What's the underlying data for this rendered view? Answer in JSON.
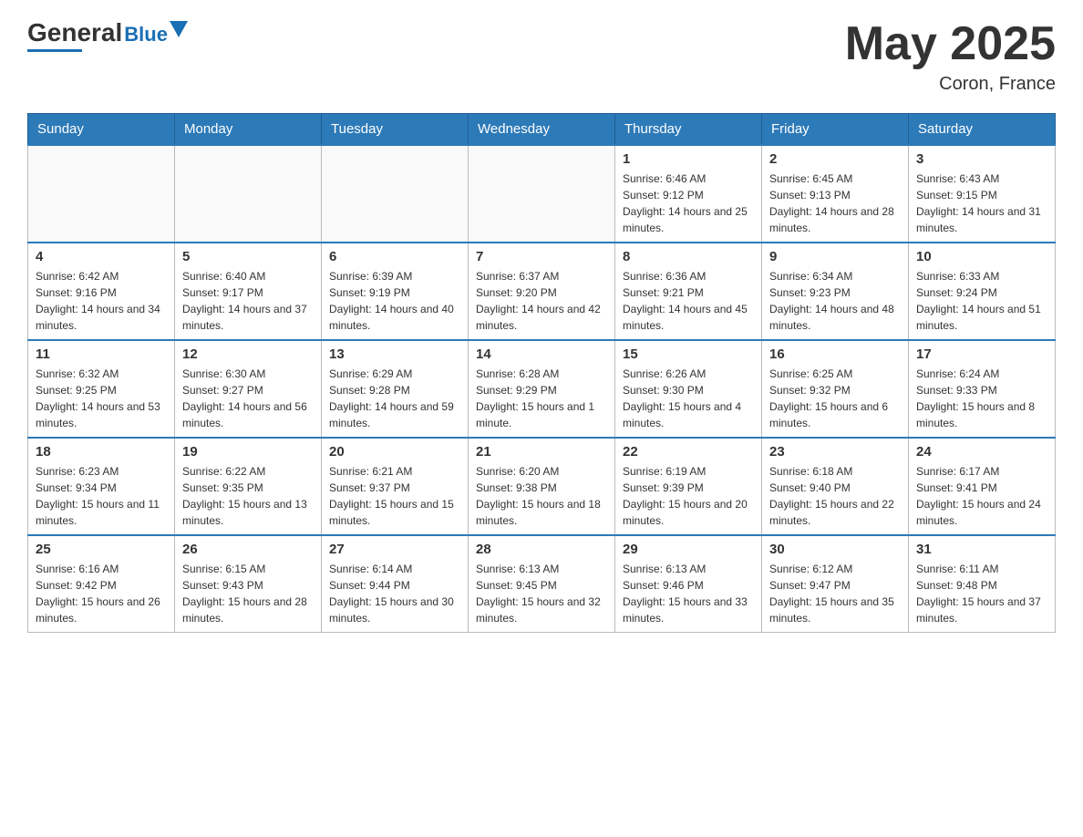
{
  "header": {
    "logo_general": "General",
    "logo_blue": "Blue",
    "title": "May 2025",
    "subtitle": "Coron, France"
  },
  "days_of_week": [
    "Sunday",
    "Monday",
    "Tuesday",
    "Wednesday",
    "Thursday",
    "Friday",
    "Saturday"
  ],
  "weeks": [
    {
      "days": [
        {
          "num": "",
          "info": ""
        },
        {
          "num": "",
          "info": ""
        },
        {
          "num": "",
          "info": ""
        },
        {
          "num": "",
          "info": ""
        },
        {
          "num": "1",
          "info": "Sunrise: 6:46 AM\nSunset: 9:12 PM\nDaylight: 14 hours and 25 minutes."
        },
        {
          "num": "2",
          "info": "Sunrise: 6:45 AM\nSunset: 9:13 PM\nDaylight: 14 hours and 28 minutes."
        },
        {
          "num": "3",
          "info": "Sunrise: 6:43 AM\nSunset: 9:15 PM\nDaylight: 14 hours and 31 minutes."
        }
      ]
    },
    {
      "days": [
        {
          "num": "4",
          "info": "Sunrise: 6:42 AM\nSunset: 9:16 PM\nDaylight: 14 hours and 34 minutes."
        },
        {
          "num": "5",
          "info": "Sunrise: 6:40 AM\nSunset: 9:17 PM\nDaylight: 14 hours and 37 minutes."
        },
        {
          "num": "6",
          "info": "Sunrise: 6:39 AM\nSunset: 9:19 PM\nDaylight: 14 hours and 40 minutes."
        },
        {
          "num": "7",
          "info": "Sunrise: 6:37 AM\nSunset: 9:20 PM\nDaylight: 14 hours and 42 minutes."
        },
        {
          "num": "8",
          "info": "Sunrise: 6:36 AM\nSunset: 9:21 PM\nDaylight: 14 hours and 45 minutes."
        },
        {
          "num": "9",
          "info": "Sunrise: 6:34 AM\nSunset: 9:23 PM\nDaylight: 14 hours and 48 minutes."
        },
        {
          "num": "10",
          "info": "Sunrise: 6:33 AM\nSunset: 9:24 PM\nDaylight: 14 hours and 51 minutes."
        }
      ]
    },
    {
      "days": [
        {
          "num": "11",
          "info": "Sunrise: 6:32 AM\nSunset: 9:25 PM\nDaylight: 14 hours and 53 minutes."
        },
        {
          "num": "12",
          "info": "Sunrise: 6:30 AM\nSunset: 9:27 PM\nDaylight: 14 hours and 56 minutes."
        },
        {
          "num": "13",
          "info": "Sunrise: 6:29 AM\nSunset: 9:28 PM\nDaylight: 14 hours and 59 minutes."
        },
        {
          "num": "14",
          "info": "Sunrise: 6:28 AM\nSunset: 9:29 PM\nDaylight: 15 hours and 1 minute."
        },
        {
          "num": "15",
          "info": "Sunrise: 6:26 AM\nSunset: 9:30 PM\nDaylight: 15 hours and 4 minutes."
        },
        {
          "num": "16",
          "info": "Sunrise: 6:25 AM\nSunset: 9:32 PM\nDaylight: 15 hours and 6 minutes."
        },
        {
          "num": "17",
          "info": "Sunrise: 6:24 AM\nSunset: 9:33 PM\nDaylight: 15 hours and 8 minutes."
        }
      ]
    },
    {
      "days": [
        {
          "num": "18",
          "info": "Sunrise: 6:23 AM\nSunset: 9:34 PM\nDaylight: 15 hours and 11 minutes."
        },
        {
          "num": "19",
          "info": "Sunrise: 6:22 AM\nSunset: 9:35 PM\nDaylight: 15 hours and 13 minutes."
        },
        {
          "num": "20",
          "info": "Sunrise: 6:21 AM\nSunset: 9:37 PM\nDaylight: 15 hours and 15 minutes."
        },
        {
          "num": "21",
          "info": "Sunrise: 6:20 AM\nSunset: 9:38 PM\nDaylight: 15 hours and 18 minutes."
        },
        {
          "num": "22",
          "info": "Sunrise: 6:19 AM\nSunset: 9:39 PM\nDaylight: 15 hours and 20 minutes."
        },
        {
          "num": "23",
          "info": "Sunrise: 6:18 AM\nSunset: 9:40 PM\nDaylight: 15 hours and 22 minutes."
        },
        {
          "num": "24",
          "info": "Sunrise: 6:17 AM\nSunset: 9:41 PM\nDaylight: 15 hours and 24 minutes."
        }
      ]
    },
    {
      "days": [
        {
          "num": "25",
          "info": "Sunrise: 6:16 AM\nSunset: 9:42 PM\nDaylight: 15 hours and 26 minutes."
        },
        {
          "num": "26",
          "info": "Sunrise: 6:15 AM\nSunset: 9:43 PM\nDaylight: 15 hours and 28 minutes."
        },
        {
          "num": "27",
          "info": "Sunrise: 6:14 AM\nSunset: 9:44 PM\nDaylight: 15 hours and 30 minutes."
        },
        {
          "num": "28",
          "info": "Sunrise: 6:13 AM\nSunset: 9:45 PM\nDaylight: 15 hours and 32 minutes."
        },
        {
          "num": "29",
          "info": "Sunrise: 6:13 AM\nSunset: 9:46 PM\nDaylight: 15 hours and 33 minutes."
        },
        {
          "num": "30",
          "info": "Sunrise: 6:12 AM\nSunset: 9:47 PM\nDaylight: 15 hours and 35 minutes."
        },
        {
          "num": "31",
          "info": "Sunrise: 6:11 AM\nSunset: 9:48 PM\nDaylight: 15 hours and 37 minutes."
        }
      ]
    }
  ]
}
